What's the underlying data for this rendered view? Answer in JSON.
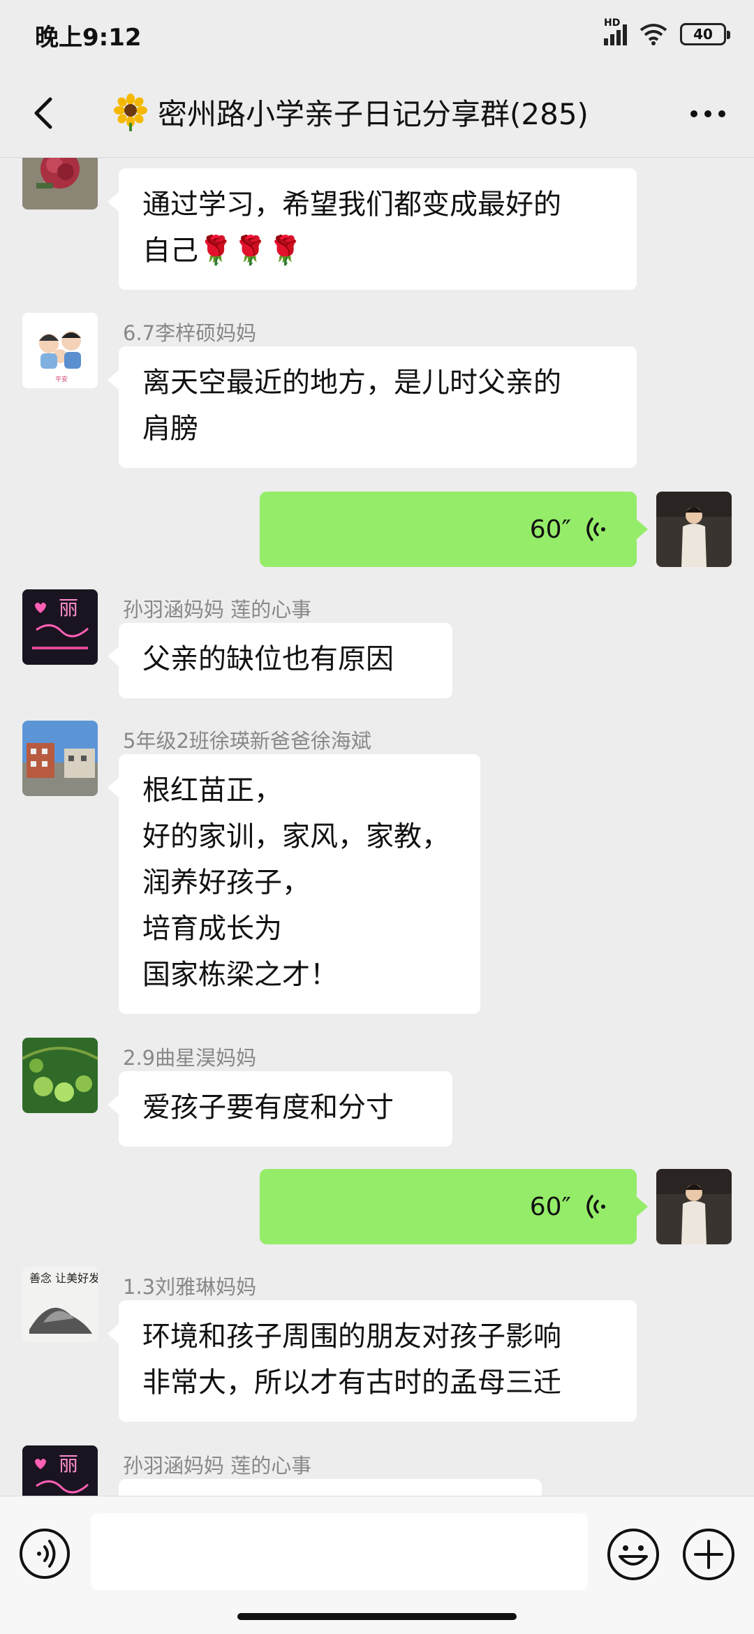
{
  "status_bar": {
    "time": "晚上9:12",
    "network": "HD",
    "battery": "40"
  },
  "header": {
    "title": "密州路小学亲子日记分享群(285)"
  },
  "messages": [
    {
      "sender": "",
      "text": "通过学习，希望我们都变成最好的\n自己🌹🌹🌹"
    },
    {
      "sender": "6.7李梓硕妈妈",
      "text": "离天空最近的地方，是儿时父亲的\n肩膀"
    },
    {
      "voice": "60″"
    },
    {
      "sender": "孙羽涵妈妈  莲的心事",
      "text": "父亲的缺位也有原因"
    },
    {
      "sender": "5年级2班徐瑛新爸爸徐海斌",
      "text": "根红苗正，\n好的家训，家风，家教，\n润养好孩子，\n培育成长为\n国家栋梁之才！"
    },
    {
      "sender": "2.9曲星淏妈妈",
      "text": "爱孩子要有度和分寸"
    },
    {
      "voice": "60″"
    },
    {
      "sender": "1.3刘雅琳妈妈",
      "text": "环境和孩子周围的朋友对孩子影响\n非常大，所以才有古时的孟母三迁"
    },
    {
      "sender": "孙羽涵妈妈  莲的心事",
      "text": ""
    }
  ],
  "avatars": {
    "li_zishuo": "平安",
    "sun_yuhan": "丽",
    "liu_yalin": "善念 让美好发生"
  },
  "input": {
    "placeholder": ""
  },
  "colors": {
    "background": "#ededed",
    "sent_bubble": "#95ec69",
    "received_bubble": "#ffffff"
  }
}
